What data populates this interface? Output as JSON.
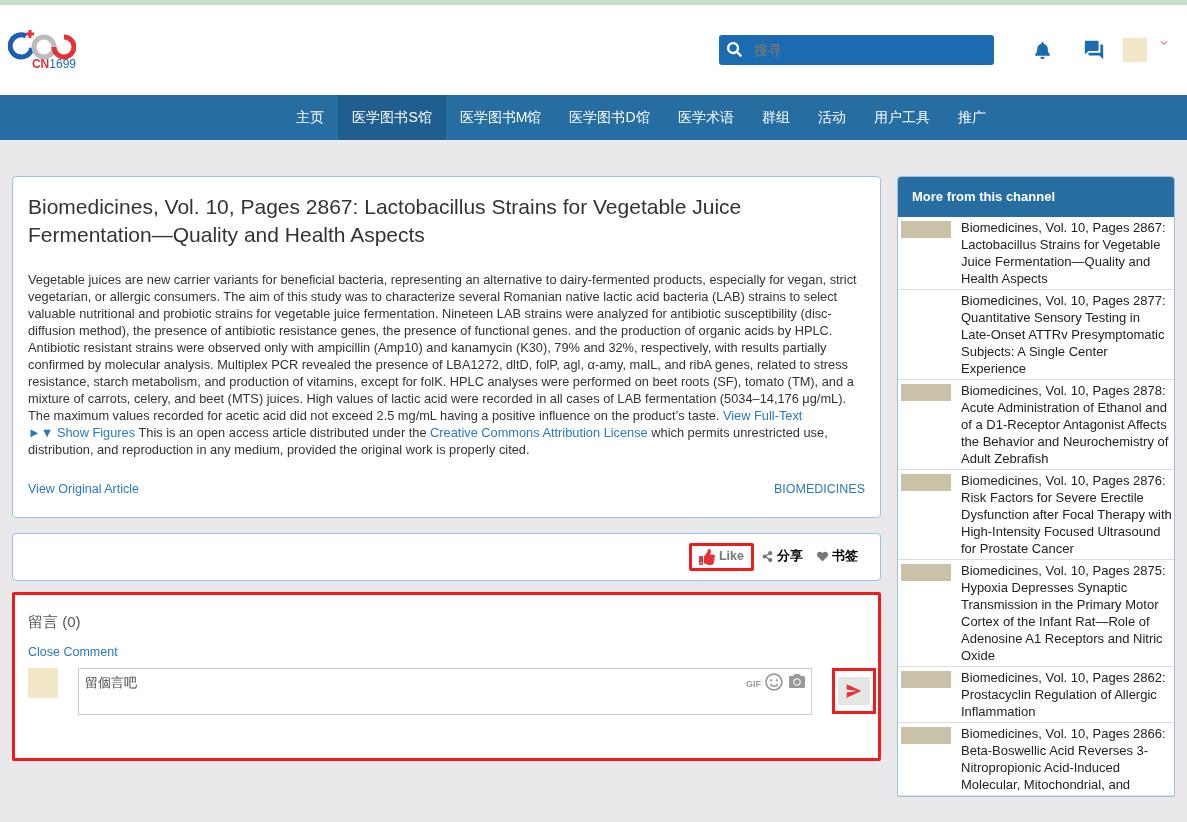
{
  "header": {
    "logo": {
      "prefix": "CN",
      "suffix": "1699"
    },
    "search": {
      "placeholder": "搜寻"
    }
  },
  "nav": [
    {
      "label": "主页",
      "selected": false
    },
    {
      "label": "医学图书S馆",
      "selected": true
    },
    {
      "label": "医学图书M馆",
      "selected": false
    },
    {
      "label": "医学图书D馆",
      "selected": false
    },
    {
      "label": "医学术语",
      "selected": false
    },
    {
      "label": "群组",
      "selected": false
    },
    {
      "label": "活动",
      "selected": false
    },
    {
      "label": "用户工具",
      "selected": false
    },
    {
      "label": "推广",
      "selected": false
    }
  ],
  "article": {
    "title": "Biomedicines, Vol. 10, Pages 2867: Lactobacillus Strains for Vegetable Juice Fermentation—Quality and Health Aspects",
    "abstract": [
      {
        "kind": "text",
        "text": "Vegetable juices are new carrier variants for beneficial bacteria, representing an alternative to dairy-fermented products, especially for vegan, strict vegetarian, or allergic consumers. The aim of this study was to characterize several Romanian native lactic acid bacteria (LAB) strains to select valuable nutritional and probiotic strains for vegetable juice fermentation. Nineteen LAB strains were analyzed for antibiotic susceptibility (disc-diffusion method), the presence of antibiotic resistance genes, the presence of functional genes. and the production of organic acids by HPLC. Antibiotic resistant strains were observed only with ampicillin (Amp10) and kanamycin (K30), 79% and 32%, respectively, with results partially confirmed by molecular analysis. Multiplex PCR revealed the presence of LBA1272, dltD, folP, agl, α-amy, malL, and ribA genes, related to stress resistance, starch metabolism, and production of vitamins, except for folK. HPLC analyses were performed on beet roots (SF), tomato (TM), and a mixture of carrots, celery, and beet (MTS) juices. High values of lactic acid were recorded in all cases of LAB fermentation (5034–14,176 μg/mL). The maximum values recorded for acetic acid did not exceed 2.5 mg/mL having a positive influence on the product’s taste. "
      },
      {
        "kind": "link",
        "text": "View Full-Text"
      },
      {
        "kind": "link",
        "text": "►▼ Show Figures"
      },
      {
        "kind": "text",
        "text": " This is an open access article distributed under the "
      },
      {
        "kind": "link",
        "text": "Creative Commons Attribution License"
      },
      {
        "kind": "text",
        "text": " which permits unrestricted use, distribution, and reproduction in any medium, provided the original work is properly cited."
      }
    ],
    "original_link": "View Original Article",
    "journal_link": "BIOMEDICINES"
  },
  "actions": {
    "like": {
      "label": "Like",
      "highlighted": true
    },
    "share": "分享",
    "bookmark": "书签"
  },
  "comments": {
    "title": "留言 (0)",
    "close_link": "Close Comment",
    "input": {
      "placeholder": "留個言吧"
    },
    "gif_label": "GIF",
    "highlighted": true,
    "send_highlighted": true
  },
  "sidebar": {
    "title": "More from this channel",
    "items": [
      {
        "title": "Biomedicines, Vol. 10, Pages 2867: Lactobacillus Strains for Vegetable Juice Fermentation—Quality and Health Aspects",
        "has_image": true
      },
      {
        "title": "Biomedicines, Vol. 10, Pages 2877: Quantitative Sensory Testing in Late-Onset ATTRv Presymptomatic Subjects: A Single Center Experience",
        "has_image": false
      },
      {
        "title": "Biomedicines, Vol. 10, Pages 2878: Acute Administration of Ethanol and of a D1-Receptor Antagonist Affects the Behavior and Neurochemistry of Adult Zebrafish",
        "has_image": true
      },
      {
        "title": "Biomedicines, Vol. 10, Pages 2876: Risk Factors for Severe Erectile Dysfunction after Focal Therapy with High-Intensity Focused Ultrasound for Prostate Cancer",
        "has_image": true
      },
      {
        "title": "Biomedicines, Vol. 10, Pages 2875: Hypoxia Depresses Synaptic Transmission in the Primary Motor Cortex of the Infant Rat—Role of Adenosine A1 Receptors and Nitric Oxide",
        "has_image": true
      },
      {
        "title": "Biomedicines, Vol. 10, Pages 2862: Prostacyclin Regulation of Allergic Inflammation",
        "has_image": true
      },
      {
        "title": "Biomedicines, Vol. 10, Pages 2866: Beta-Boswellic Acid Reverses 3-Nitropropionic Acid-Induced Molecular, Mitochondrial, and",
        "has_image": true
      }
    ]
  }
}
